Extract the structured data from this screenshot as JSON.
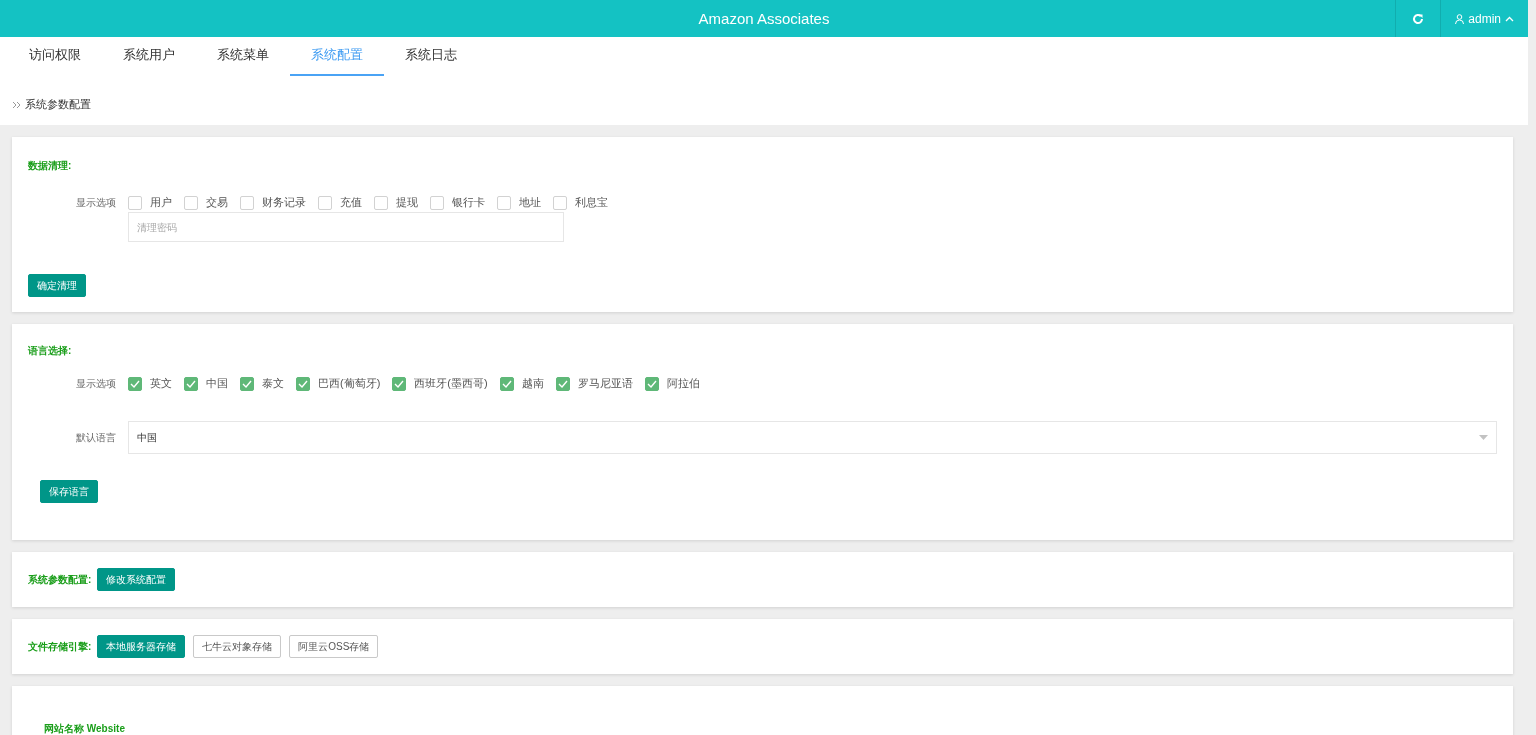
{
  "header": {
    "title": "Amazon Associates",
    "user": "admin"
  },
  "tabs": [
    {
      "label": "访问权限",
      "selected": false
    },
    {
      "label": "系统用户",
      "selected": false
    },
    {
      "label": "系统菜单",
      "selected": false
    },
    {
      "label": "系统配置",
      "selected": true
    },
    {
      "label": "系统日志",
      "selected": false
    }
  ],
  "breadcrumb": "系统参数配置",
  "data_cleanup": {
    "title": "数据清理:",
    "options_label": "显示选项",
    "options": [
      {
        "label": "用户",
        "checked": false
      },
      {
        "label": "交易",
        "checked": false
      },
      {
        "label": "财务记录",
        "checked": false
      },
      {
        "label": "充值",
        "checked": false
      },
      {
        "label": "提现",
        "checked": false
      },
      {
        "label": "银行卡",
        "checked": false
      },
      {
        "label": "地址",
        "checked": false
      },
      {
        "label": "利息宝",
        "checked": false
      }
    ],
    "password_placeholder": "清理密码",
    "button": "确定清理"
  },
  "language": {
    "title": "语言选择:",
    "options_label": "显示选项",
    "options": [
      {
        "label": "英文",
        "checked": true
      },
      {
        "label": "中国",
        "checked": true
      },
      {
        "label": "泰文",
        "checked": true
      },
      {
        "label": "巴西(葡萄牙)",
        "checked": true
      },
      {
        "label": "西班牙(墨西哥)",
        "checked": true
      },
      {
        "label": "越南",
        "checked": true
      },
      {
        "label": "罗马尼亚语",
        "checked": true
      },
      {
        "label": "阿拉伯",
        "checked": true
      }
    ],
    "default_label": "默认语言",
    "default_value": "中国",
    "button": "保存语言"
  },
  "system_params": {
    "title": "系统参数配置:",
    "button": "修改系统配置"
  },
  "storage": {
    "title": "文件存储引擎:",
    "options": [
      {
        "label": "本地服务器存储",
        "selected": true
      },
      {
        "label": "七牛云对象存储",
        "selected": false
      },
      {
        "label": "阿里云OSS存储",
        "selected": false
      }
    ]
  },
  "site": {
    "name_label": "网站名称 Website"
  }
}
